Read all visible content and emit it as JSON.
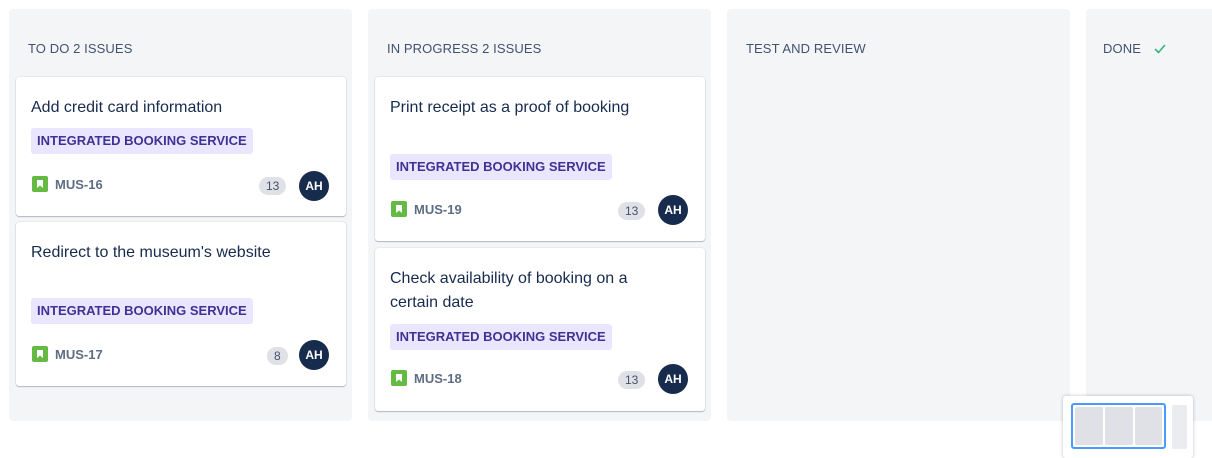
{
  "columns": [
    {
      "title": "TO DO 2 ISSUES",
      "cards": [
        {
          "title": "Add credit card information",
          "epic": "INTEGRATED BOOKING SERVICE",
          "key": "MUS-16",
          "estimate": "13",
          "assignee": "AH"
        },
        {
          "title": "Redirect to the museum's website",
          "epic": "INTEGRATED BOOKING SERVICE",
          "key": "MUS-17",
          "estimate": "8",
          "assignee": "AH"
        }
      ]
    },
    {
      "title": "IN PROGRESS 2 ISSUES",
      "cards": [
        {
          "title": "Print receipt as a proof of booking",
          "epic": "INTEGRATED BOOKING SERVICE",
          "key": "MUS-19",
          "estimate": "13",
          "assignee": "AH"
        },
        {
          "title": "Check availability of booking on a certain date",
          "epic": "INTEGRATED BOOKING SERVICE",
          "key": "MUS-18",
          "estimate": "13",
          "assignee": "AH"
        }
      ]
    },
    {
      "title": "TEST AND REVIEW",
      "cards": []
    },
    {
      "title": "DONE",
      "cards": []
    }
  ],
  "icons": {
    "story": "story-bookmark-icon",
    "done": "checkmark-icon"
  },
  "colors": {
    "column_bg": "#f4f5f7",
    "epic_bg": "#eae6ff",
    "epic_text": "#403294",
    "story_icon": "#65ba43",
    "avatar_bg": "#172b4d",
    "done_check": "#36b37e",
    "minimap_focus": "#4c9aff"
  }
}
